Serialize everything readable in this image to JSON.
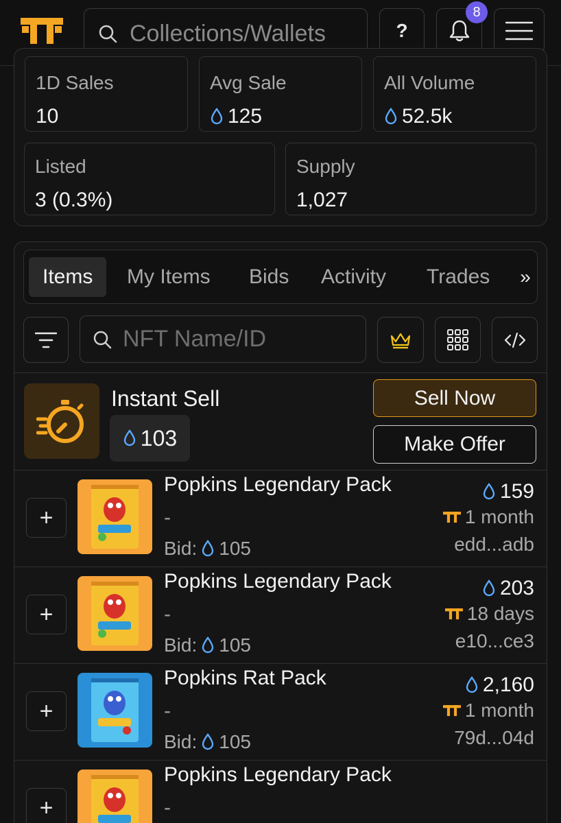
{
  "colors": {
    "accent": "#f5a623",
    "sol_drop": "#5aa9ff",
    "badge": "#6c5ce7"
  },
  "header": {
    "search_placeholder": "Collections/Wallets",
    "help_label": "?",
    "notification_count": "8"
  },
  "stats": {
    "d1_sales": {
      "label": "1D Sales",
      "value": "10"
    },
    "avg_sale": {
      "label": "Avg Sale",
      "value": "125"
    },
    "all_volume": {
      "label": "All Volume",
      "value": "52.5k"
    },
    "listed": {
      "label": "Listed",
      "value": "3 (0.3%)"
    },
    "supply": {
      "label": "Supply",
      "value": "1,027"
    }
  },
  "tabs": [
    {
      "label": "Items",
      "active": true
    },
    {
      "label": "My Items"
    },
    {
      "label": "Bids"
    },
    {
      "label": "Activity"
    },
    {
      "label": "Trades"
    }
  ],
  "tabs_more": "»",
  "controls": {
    "nft_search_placeholder": "NFT Name/ID"
  },
  "instant_sell": {
    "title": "Instant Sell",
    "price": "103",
    "sell_now": "Sell Now",
    "make_offer": "Make Offer"
  },
  "items": [
    {
      "name": "Popkins Legendary Pack",
      "sub": "-",
      "bid_label": "Bid:",
      "bid": "105",
      "price": "159",
      "time": "1 month",
      "seller": "edd...adb",
      "pack": "orange"
    },
    {
      "name": "Popkins Legendary Pack",
      "sub": "-",
      "bid_label": "Bid:",
      "bid": "105",
      "price": "203",
      "time": "18 days",
      "seller": "e10...ce3",
      "pack": "orange"
    },
    {
      "name": "Popkins Rat Pack",
      "sub": "-",
      "bid_label": "Bid:",
      "bid": "105",
      "price": "2,160",
      "time": "1 month",
      "seller": "79d...04d",
      "pack": "blue"
    },
    {
      "name": "Popkins Legendary Pack",
      "sub": "-",
      "pack": "orange"
    }
  ]
}
